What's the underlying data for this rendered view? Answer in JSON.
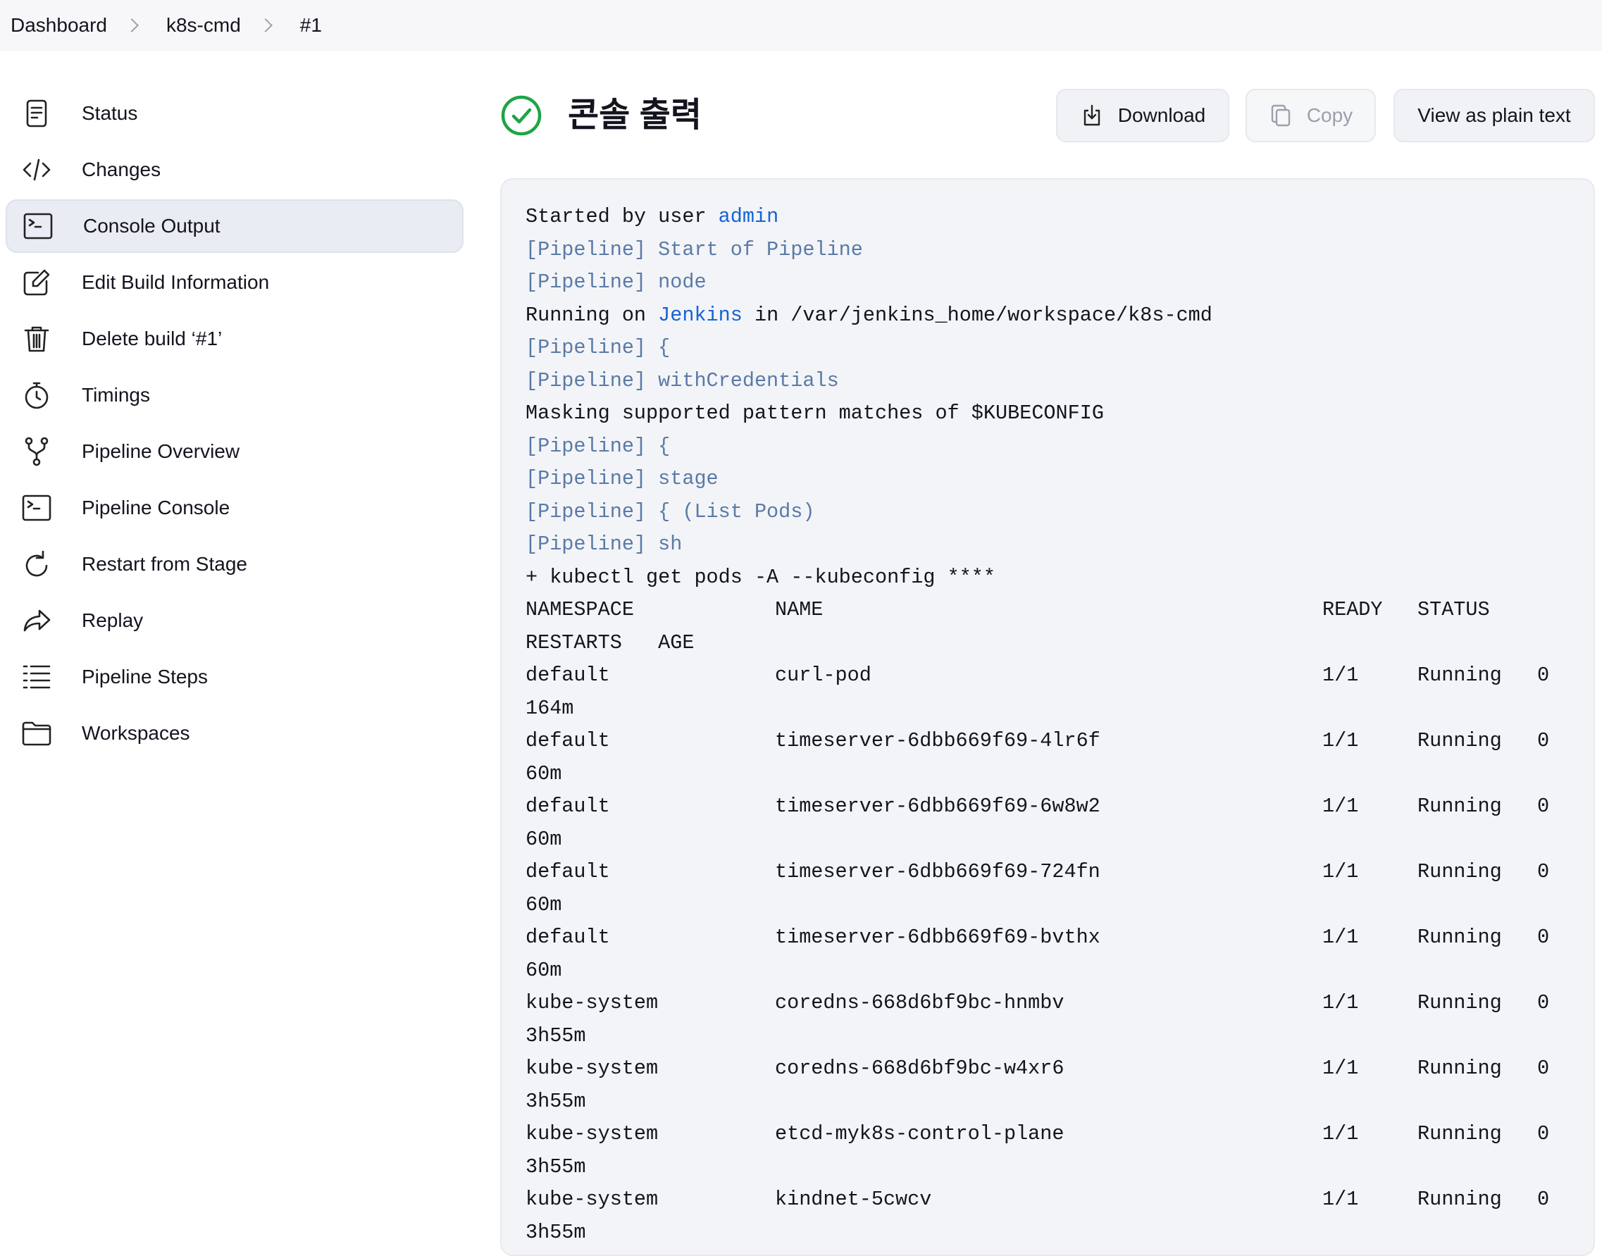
{
  "breadcrumb": [
    "Dashboard",
    "k8s-cmd",
    "#1"
  ],
  "sidebar": {
    "items": [
      {
        "label": "Status",
        "icon": "status-icon"
      },
      {
        "label": "Changes",
        "icon": "code-icon"
      },
      {
        "label": "Console Output",
        "icon": "terminal-icon",
        "active": true
      },
      {
        "label": "Edit Build Information",
        "icon": "edit-icon"
      },
      {
        "label": "Delete build ‘#1’",
        "icon": "trash-icon"
      },
      {
        "label": "Timings",
        "icon": "stopwatch-icon"
      },
      {
        "label": "Pipeline Overview",
        "icon": "branch-icon"
      },
      {
        "label": "Pipeline Console",
        "icon": "terminal-icon"
      },
      {
        "label": "Restart from Stage",
        "icon": "restart-icon"
      },
      {
        "label": "Replay",
        "icon": "replay-icon"
      },
      {
        "label": "Pipeline Steps",
        "icon": "list-icon"
      },
      {
        "label": "Workspaces",
        "icon": "folder-icon"
      }
    ]
  },
  "header": {
    "title": "콘솔 출력",
    "status_icon": "success-check-icon",
    "download_label": "Download",
    "copy_label": "Copy",
    "plain_text_label": "View as plain text"
  },
  "console": {
    "started_prefix": "Started by user ",
    "started_user": "admin",
    "line_pipeline_start": "[Pipeline] Start of Pipeline",
    "line_pipeline_node": "[Pipeline] node",
    "running_prefix": "Running on ",
    "running_link": "Jenkins",
    "running_suffix": " in /var/jenkins_home/workspace/k8s-cmd",
    "line_pipeline_brace1": "[Pipeline] {",
    "line_pipeline_withcred": "[Pipeline] withCredentials",
    "line_masking": "Masking supported pattern matches of $KUBECONFIG",
    "line_pipeline_brace2": "[Pipeline] {",
    "line_pipeline_stage": "[Pipeline] stage",
    "line_pipeline_listpods": "[Pipeline] { (List Pods)",
    "line_pipeline_sh": "[Pipeline] sh",
    "line_command": "+ kubectl get pods -A --kubeconfig ****",
    "table_headers": [
      "NAMESPACE",
      "NAME",
      "READY",
      "STATUS",
      "RESTARTS   AGE"
    ],
    "rows": [
      {
        "namespace": "default",
        "name": "curl-pod",
        "ready": "1/1",
        "status": "Running",
        "restarts": "0",
        "age": "164m"
      },
      {
        "namespace": "default",
        "name": "timeserver-6dbb669f69-4lr6f",
        "ready": "1/1",
        "status": "Running",
        "restarts": "0",
        "age": "60m"
      },
      {
        "namespace": "default",
        "name": "timeserver-6dbb669f69-6w8w2",
        "ready": "1/1",
        "status": "Running",
        "restarts": "0",
        "age": "60m"
      },
      {
        "namespace": "default",
        "name": "timeserver-6dbb669f69-724fn",
        "ready": "1/1",
        "status": "Running",
        "restarts": "0",
        "age": "60m"
      },
      {
        "namespace": "default",
        "name": "timeserver-6dbb669f69-bvthx",
        "ready": "1/1",
        "status": "Running",
        "restarts": "0",
        "age": "60m"
      },
      {
        "namespace": "kube-system",
        "name": "coredns-668d6bf9bc-hnmbv",
        "ready": "1/1",
        "status": "Running",
        "restarts": "0",
        "age": "3h55m"
      },
      {
        "namespace": "kube-system",
        "name": "coredns-668d6bf9bc-w4xr6",
        "ready": "1/1",
        "status": "Running",
        "restarts": "0",
        "age": "3h55m"
      },
      {
        "namespace": "kube-system",
        "name": "etcd-myk8s-control-plane",
        "ready": "1/1",
        "status": "Running",
        "restarts": "0",
        "age": "3h55m"
      },
      {
        "namespace": "kube-system",
        "name": "kindnet-5cwcv",
        "ready": "1/1",
        "status": "Running",
        "restarts": "0",
        "age": "3h55m"
      }
    ]
  },
  "colors": {
    "success": "#1ea446",
    "link": "#1663d6",
    "pipeline": "#5a7aa8",
    "active_bg": "#e9ecf3"
  }
}
